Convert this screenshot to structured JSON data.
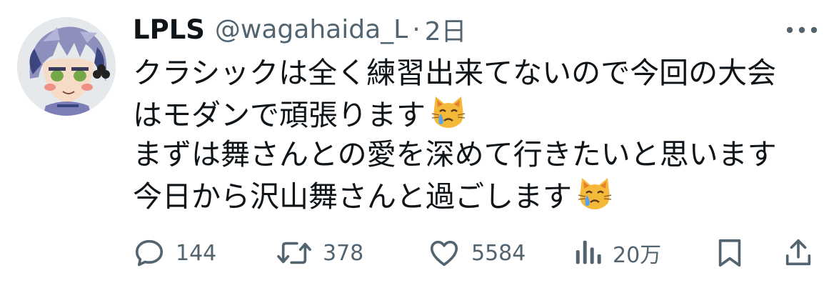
{
  "tweet": {
    "author": {
      "display_name": "LPLS",
      "handle": "@wagahaida_L",
      "avatar_icon": "anime-character-avatar-icon"
    },
    "separator": "·",
    "timestamp": "2日",
    "more_icon": "more-horizontal-icon",
    "lines": [
      "クラシックは全く練習出来てないので今回の大会",
      "はモダンで頑張ります",
      "まずは舞さんとの愛を深めて行きたいと思います",
      "今日から沢山舞さんと過ごします"
    ],
    "emoji": "crying-cat-face-emoji",
    "metrics": {
      "replies": "144",
      "reposts": "378",
      "likes": "5584",
      "views": "20万"
    },
    "icons": {
      "reply": "reply-bubble-icon",
      "repost": "repost-icon",
      "like": "heart-icon",
      "views": "views-bar-chart-icon",
      "bookmark": "bookmark-icon",
      "share": "share-upload-icon"
    },
    "colors": {
      "text": "#0f1419",
      "secondary": "#536471"
    }
  }
}
